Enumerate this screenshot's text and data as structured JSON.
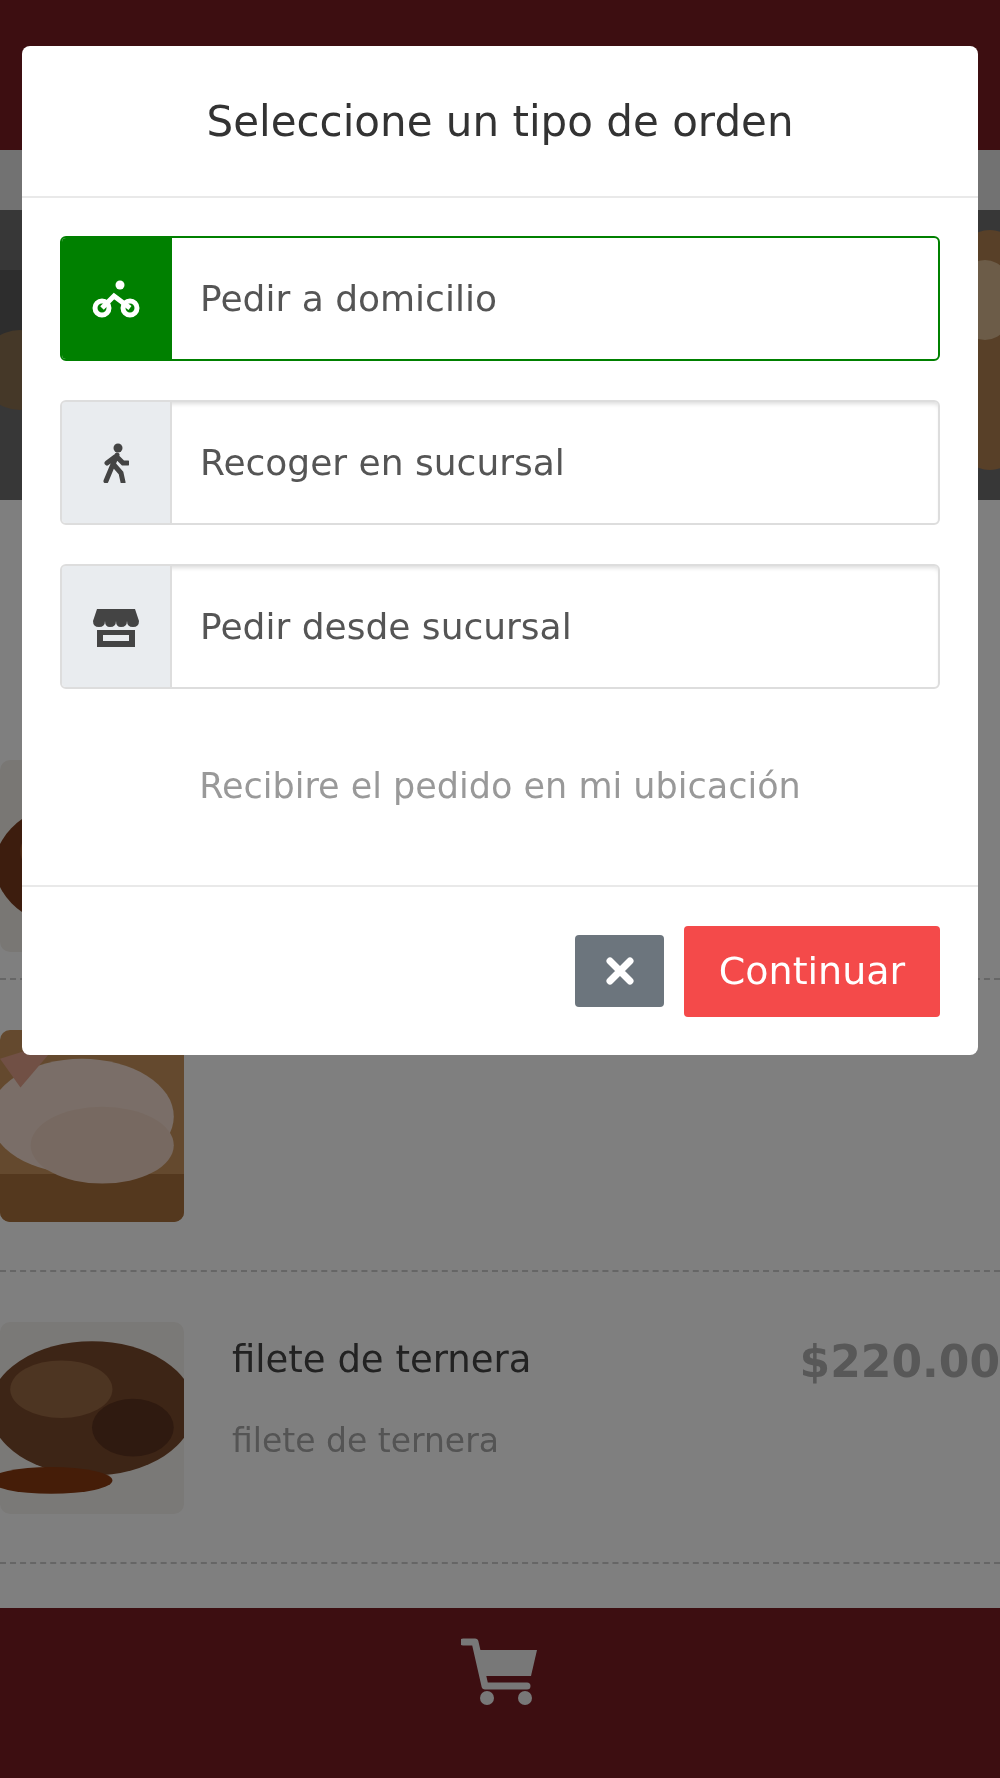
{
  "products": [
    {
      "image": {
        "kind": "picture"
      }
    },
    {
      "image": {
        "kind": "picture"
      }
    },
    {
      "image": {
        "kind": "picture"
      },
      "name": "filete de ternera",
      "description": "filete de ternera",
      "price": "$220.00"
    }
  ],
  "modal": {
    "title": "Seleccione un tipo de orden",
    "options": [
      {
        "kind": "delivery",
        "label": "Pedir a domicilio",
        "selected": true
      },
      {
        "kind": "pickup",
        "label": "Recoger en sucursal",
        "selected": false
      },
      {
        "kind": "store",
        "label": "Pedir desde sucursal",
        "selected": false
      }
    ],
    "hint": "Recibire el pedido en mi ubicación",
    "buttons": [
      {
        "kind": "close"
      },
      {
        "kind": "primary",
        "label": "Continuar"
      }
    ]
  }
}
